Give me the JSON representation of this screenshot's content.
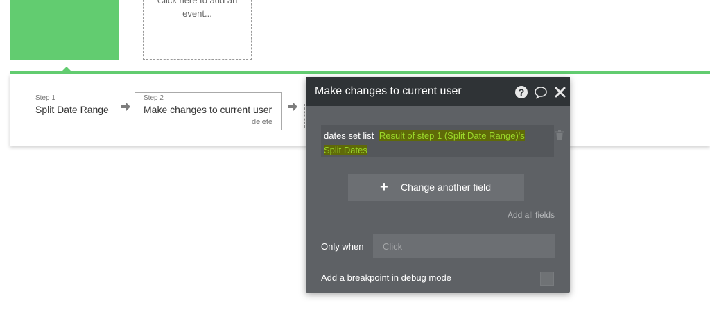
{
  "event_placeholder": {
    "line1": "Click here to add an",
    "line2": "event..."
  },
  "steps": [
    {
      "number": "Step 1",
      "title": "Split Date Range"
    },
    {
      "number": "Step 2",
      "title": "Make changes to current user",
      "delete_label": "delete"
    }
  ],
  "panel": {
    "title": "Make changes to current user",
    "icons": [
      "help-icon",
      "comment-icon",
      "close-icon"
    ],
    "field": {
      "label": "dates set list",
      "value_line1": "Result of step 1 (Split Date Range)'s",
      "value_line2": "Split Dates"
    },
    "change_another_field": "Change another field",
    "add_all_fields": "Add all fields",
    "only_when_label": "Only when",
    "only_when_placeholder": "Click",
    "breakpoint_label": "Add a breakpoint in debug mode"
  },
  "colors": {
    "green": "#62cc70",
    "panel_bg": "#5e6165",
    "panel_header": "#2f3336",
    "dynamic_value": "#9ad82a"
  }
}
